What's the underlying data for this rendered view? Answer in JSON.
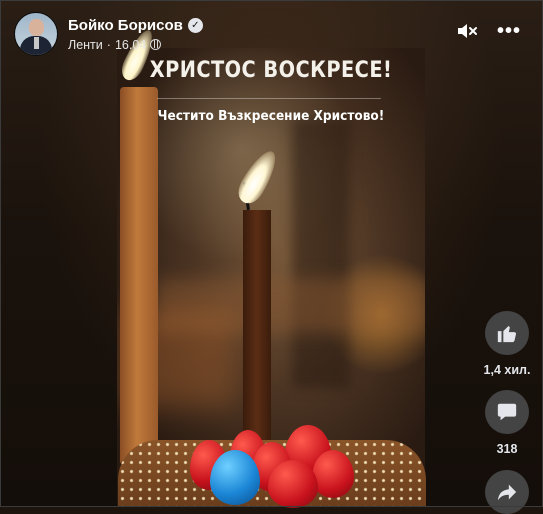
{
  "post": {
    "author_name": "Бойко Борисов",
    "source": "Ленти",
    "separator": "·",
    "date": "16.04"
  },
  "video": {
    "title": "ХРИСТОС ВОСКРЕСЕ!",
    "subtitle": "Честито Възкресение Христово!"
  },
  "actions": {
    "likes_count": "1,4 хил.",
    "comments_count": "318"
  },
  "icons": {
    "verified": "verified-badge-icon",
    "audience": "globe-icon",
    "mute": "speaker-muted-icon",
    "more": "more-options-icon",
    "like": "thumbs-up-icon",
    "comment": "comment-bubble-icon",
    "share": "share-arrow-icon"
  },
  "colors": {
    "action_button_bg": "#444444",
    "text_primary": "#ffffff"
  }
}
